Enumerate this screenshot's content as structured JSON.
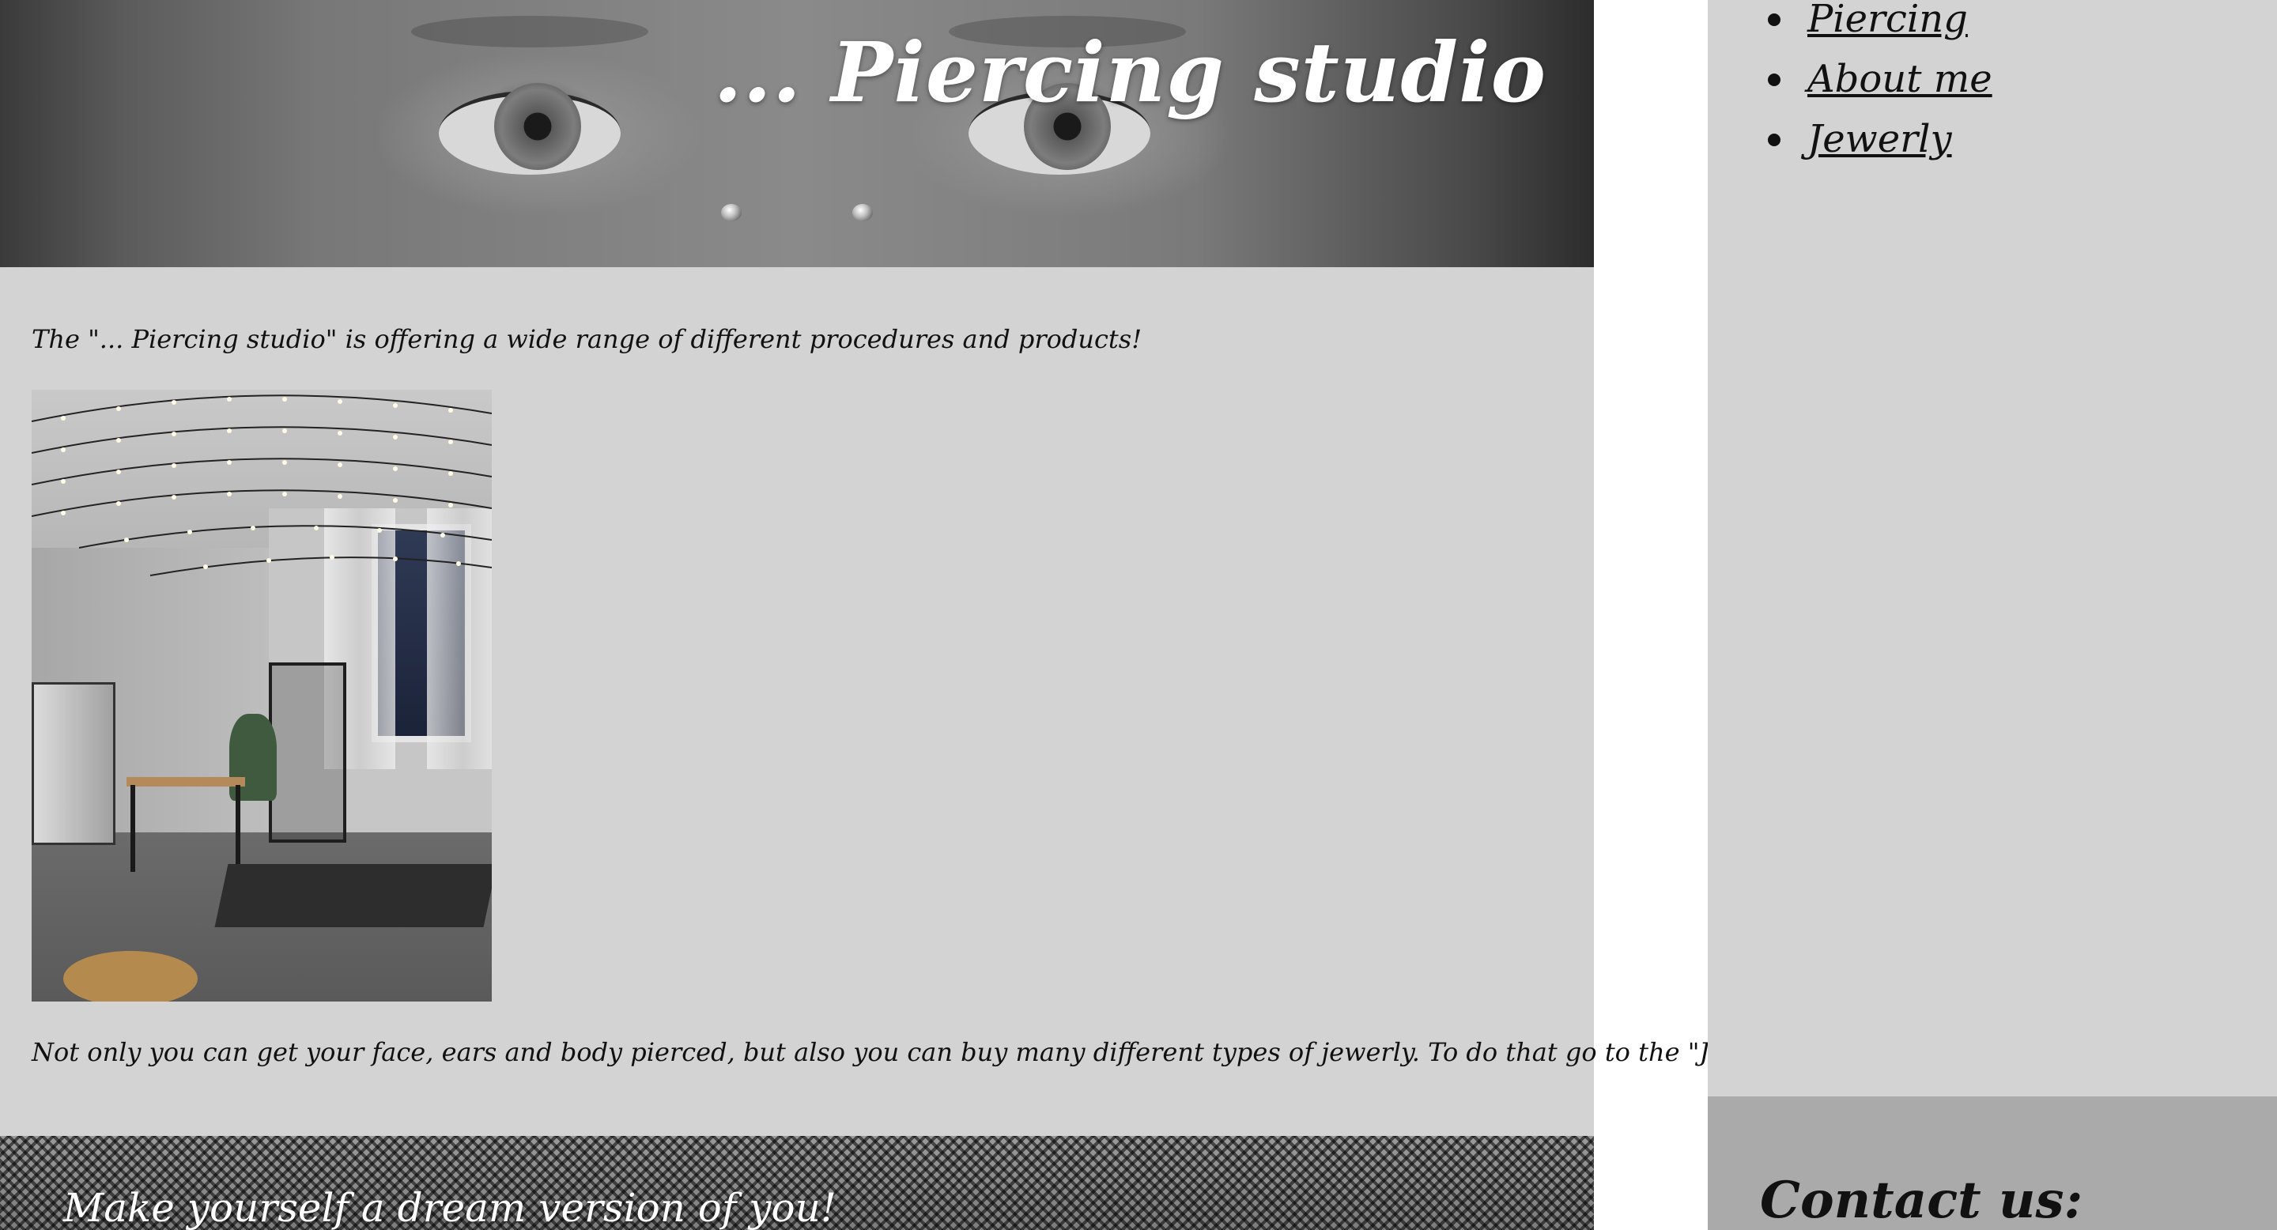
{
  "hero": {
    "title": "... Piercing studio"
  },
  "main": {
    "intro_text": "The \"... Piercing studio\" is offering a wide range of different procedures and products!",
    "body_text": "Not only you can get your face, ears and body pierced, but also you can buy many different types of jewerly. To do that go to the \"Jewerly\"",
    "banner_text": "Make yourself a dream version of you!"
  },
  "sidebar": {
    "items": [
      {
        "label": "Piercing"
      },
      {
        "label": "About me"
      },
      {
        "label": "Jewerly"
      }
    ]
  },
  "contact": {
    "heading": "Contact us:"
  },
  "colors": {
    "page_bg": "#d3d3d3",
    "contact_bg": "#aaaaaa",
    "text": "#111111"
  }
}
